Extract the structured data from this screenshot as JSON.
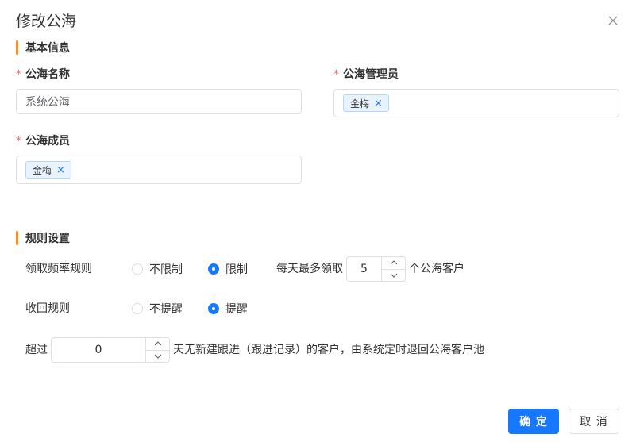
{
  "dialog": {
    "title": "修改公海",
    "close_icon": "close-icon"
  },
  "basic_section": {
    "title": "基本信息",
    "pool_name": {
      "required_mark": "*",
      "label": "公海名称",
      "value": "系统公海"
    },
    "pool_admin": {
      "required_mark": "*",
      "label": "公海管理员",
      "tags": [
        "金梅"
      ],
      "tag_close": "×"
    },
    "pool_members": {
      "required_mark": "*",
      "label": "公海成员",
      "tags": [
        "金梅"
      ],
      "tag_close": "×"
    }
  },
  "rules_section": {
    "title": "规则设置",
    "claim_rule": {
      "label": "领取频率规则",
      "options": [
        "不限制",
        "限制"
      ],
      "selected": "限制",
      "prefix": "每天最多领取",
      "value": "5",
      "suffix": "个公海客户"
    },
    "recycle_rule": {
      "label": "收回规则",
      "options": [
        "不提醒",
        "提醒"
      ],
      "selected": "提醒"
    },
    "timeout": {
      "prefix": "超过",
      "value": "0",
      "suffix": "天无新建跟进（跟进记录）的客户，由系统定时退回公海客户池"
    }
  },
  "footer": {
    "confirm_label": "确 定",
    "cancel_label": "取 消"
  },
  "colors": {
    "accent": "#1677ff",
    "section_bar": "#ff8f1f",
    "required": "#f56c6c"
  }
}
